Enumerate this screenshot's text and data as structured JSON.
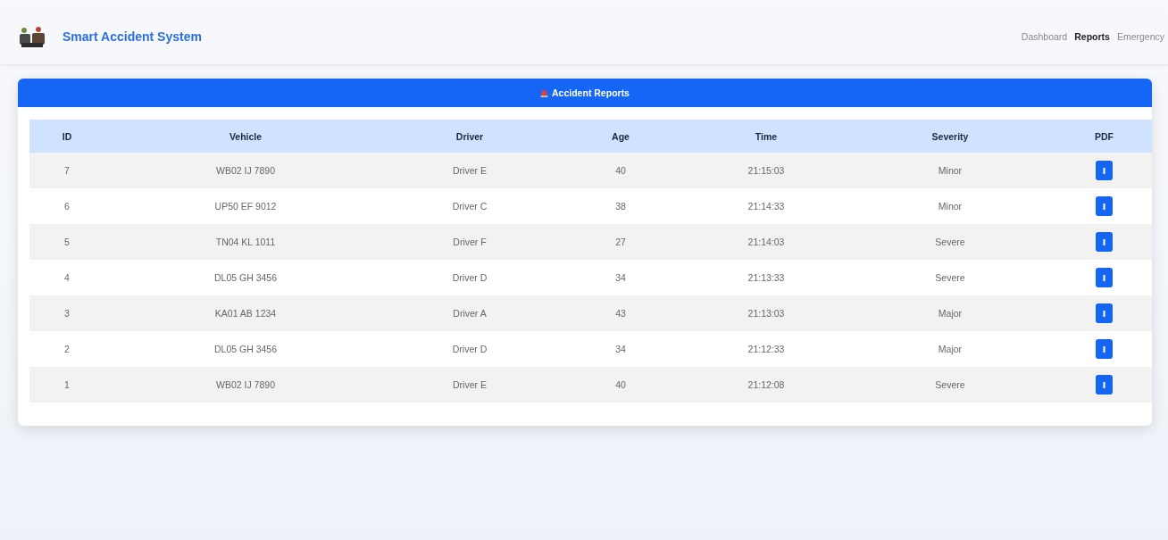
{
  "navbar": {
    "title": "Smart Accident System",
    "links": [
      {
        "label": "Dashboard",
        "selected": false
      },
      {
        "label": "Reports",
        "selected": true
      },
      {
        "label": "Emergency",
        "selected": false
      }
    ]
  },
  "card": {
    "title": "Accident Reports"
  },
  "table": {
    "columns": [
      "ID",
      "Vehicle",
      "Driver",
      "Age",
      "Time",
      "Severity",
      "PDF"
    ],
    "rows": [
      {
        "id": "7",
        "vehicle": "WB02 IJ 7890",
        "driver": "Driver E",
        "age": "40",
        "time": "21:15:03",
        "severity": "Minor"
      },
      {
        "id": "6",
        "vehicle": "UP50 EF 9012",
        "driver": "Driver C",
        "age": "38",
        "time": "21:14:33",
        "severity": "Minor"
      },
      {
        "id": "5",
        "vehicle": "TN04 KL 1011",
        "driver": "Driver F",
        "age": "27",
        "time": "21:14:03",
        "severity": "Severe"
      },
      {
        "id": "4",
        "vehicle": "DL05 GH 3456",
        "driver": "Driver D",
        "age": "34",
        "time": "21:13:33",
        "severity": "Severe"
      },
      {
        "id": "3",
        "vehicle": "KA01 AB 1234",
        "driver": "Driver A",
        "age": "43",
        "time": "21:13:03",
        "severity": "Major"
      },
      {
        "id": "2",
        "vehicle": "DL05 GH 3456",
        "driver": "Driver D",
        "age": "34",
        "time": "21:12:33",
        "severity": "Major"
      },
      {
        "id": "1",
        "vehicle": "WB02 IJ 7890",
        "driver": "Driver E",
        "age": "40",
        "time": "21:12:08",
        "severity": "Severe"
      }
    ]
  }
}
